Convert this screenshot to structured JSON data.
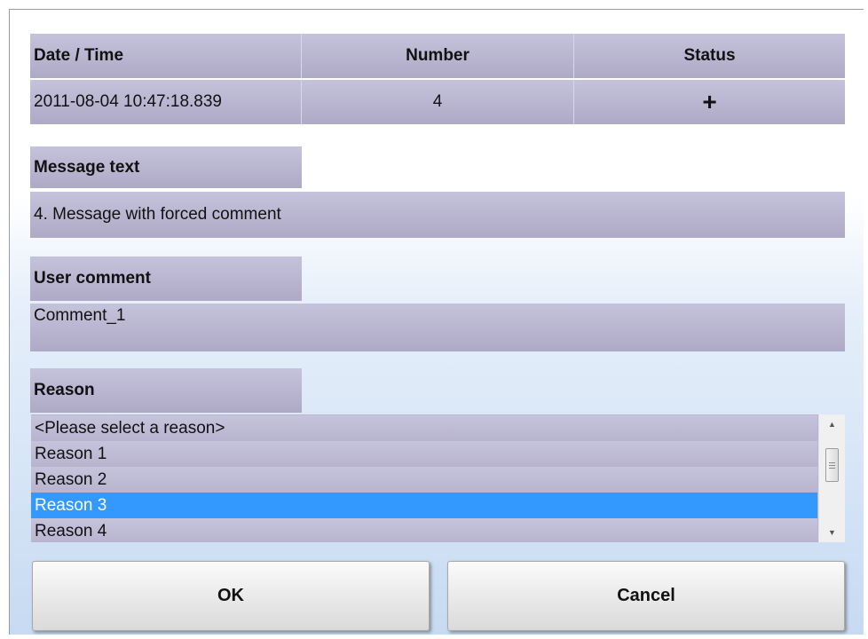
{
  "table": {
    "headers": {
      "date_time": "Date / Time",
      "number": "Number",
      "status": "Status"
    },
    "row": {
      "date_time": "2011-08-04 10:47:18.839",
      "number": "4",
      "status": "+"
    }
  },
  "message": {
    "label": "Message text",
    "value": "4. Message with forced comment"
  },
  "comment": {
    "label": "User comment",
    "value": "Comment_1"
  },
  "reason": {
    "label": "Reason",
    "options": [
      "<Please select a reason>",
      "Reason 1",
      "Reason 2",
      "Reason 3",
      "Reason 4"
    ],
    "selected_index": 3,
    "selected_value": "Reason 3"
  },
  "scrollbar": {
    "up_icon": "scroll-up-arrow",
    "down_icon": "scroll-down-arrow"
  },
  "buttons": {
    "ok": "OK",
    "cancel": "Cancel"
  },
  "colors": {
    "cell_bg": "#b9b5d0",
    "selected_bg": "#3399ff",
    "selected_text": "#ffffff"
  }
}
